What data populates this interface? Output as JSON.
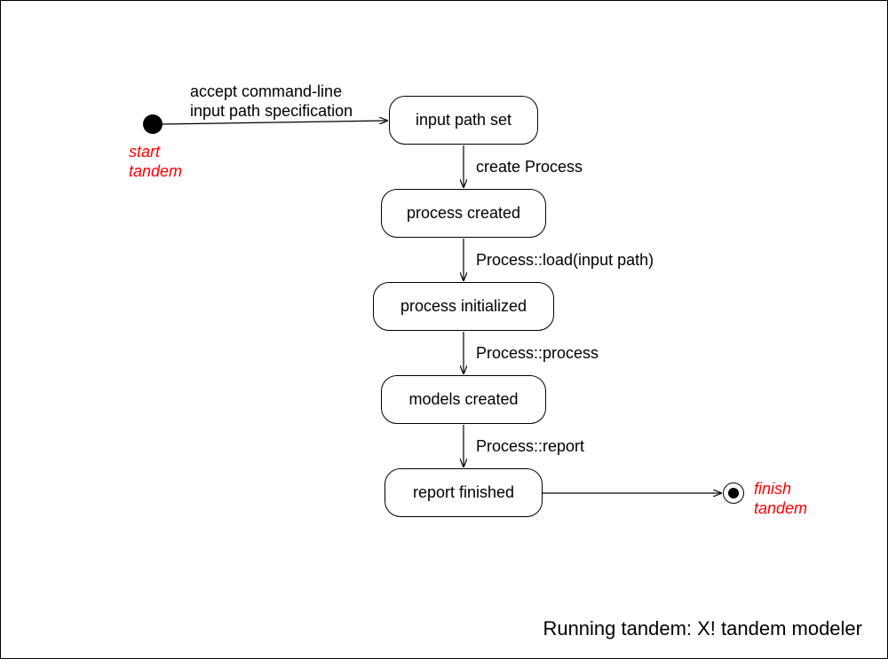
{
  "start": {
    "label": "start\ntandem"
  },
  "end": {
    "label": "finish\ntandem"
  },
  "states": {
    "s1": "input path set",
    "s2": "process created",
    "s3": "process initialized",
    "s4": "models created",
    "s5": "report finished"
  },
  "transitions": {
    "t0": "accept command-line\ninput path specification",
    "t1": "create Process",
    "t2": "Process::load(input path)",
    "t3": "Process::process",
    "t4": "Process::report"
  },
  "caption": "Running tandem: X! tandem modeler"
}
